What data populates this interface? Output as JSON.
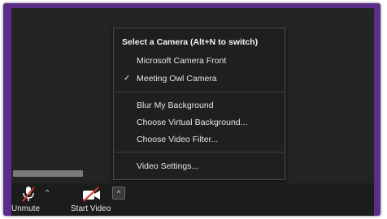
{
  "camera_menu": {
    "header": "Select a Camera (Alt+N to switch)",
    "cameras": [
      {
        "label": "Microsoft Camera Front",
        "selected": false
      },
      {
        "label": "Meeting Owl Camera",
        "selected": true
      }
    ],
    "background_options": [
      {
        "label": "Blur My Background"
      },
      {
        "label": "Choose Virtual Background..."
      },
      {
        "label": "Choose Video Filter..."
      }
    ],
    "settings_label": "Video Settings...",
    "check_glyph": "✓"
  },
  "toolbar": {
    "unmute_label": "Unmute",
    "start_video_label": "Start Video",
    "caret_glyph": "^",
    "mic_icon": "microphone-muted-icon",
    "video_icon": "video-camera-off-icon"
  },
  "colors": {
    "frame": "#5b2d8a",
    "window_bg": "#242424",
    "menu_bg": "#1f1f1f",
    "muted_red": "#d9342b"
  }
}
